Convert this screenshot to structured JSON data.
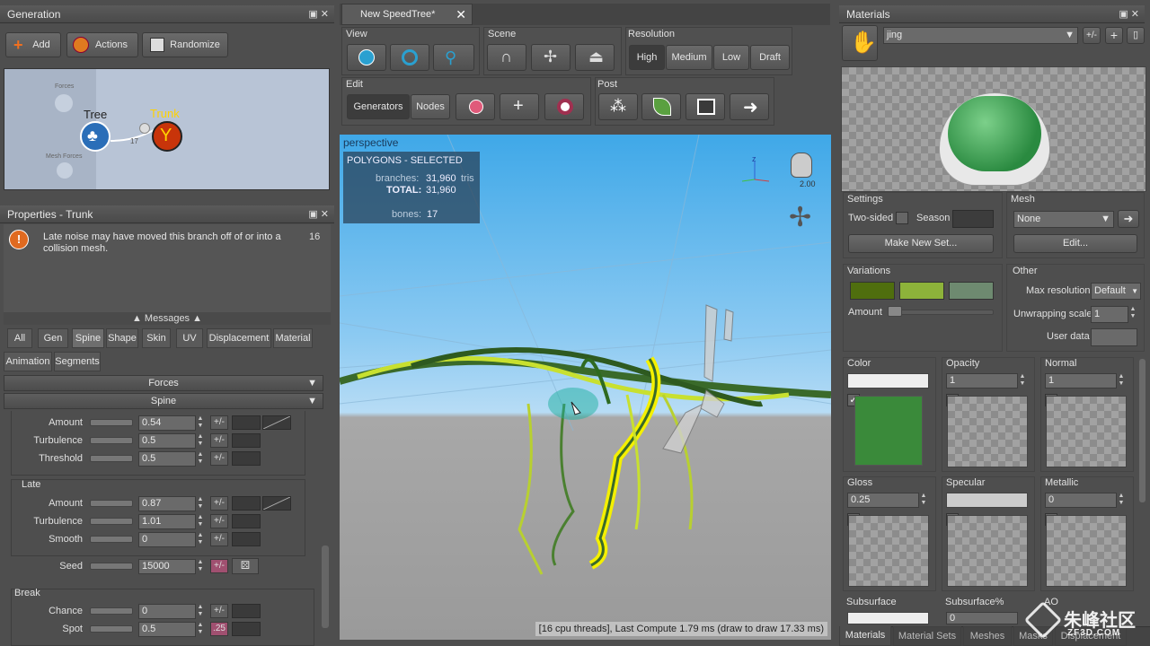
{
  "generation": {
    "title": "Generation",
    "add": "Add",
    "actions": "Actions",
    "randomize": "Randomize",
    "node_tree": "Tree",
    "node_trunk": "Trunk",
    "node_forces": "Forces",
    "node_mesh_forces": "Mesh Forces",
    "link_count": "17"
  },
  "properties": {
    "title": "Properties - Trunk",
    "message": "Late noise may have moved this branch off of or into a collision mesh.",
    "message_count": "16",
    "messages_header": "Messages",
    "tabs": [
      "All",
      "Gen",
      "Spine",
      "Shape",
      "Skin",
      "UV",
      "Displacement",
      "Material",
      "Animation",
      "Segments"
    ],
    "section_forces": "Forces",
    "section_spine": "Spine",
    "rows1": [
      {
        "label": "Amount",
        "value": "0.54"
      },
      {
        "label": "Turbulence",
        "value": "0.5"
      },
      {
        "label": "Threshold",
        "value": "0.5"
      }
    ],
    "late_label": "Late",
    "rows2": [
      {
        "label": "Amount",
        "value": "0.87"
      },
      {
        "label": "Turbulence",
        "value": "1.01"
      },
      {
        "label": "Smooth",
        "value": "0"
      }
    ],
    "seed_label": "Seed",
    "seed_value": "15000",
    "break_label": "Break",
    "rows3": [
      {
        "label": "Chance",
        "value": "0"
      },
      {
        "label": "Spot",
        "value": "0.5",
        "badge": ".25"
      }
    ],
    "pm": "+/-"
  },
  "doc": {
    "tab": "New SpeedTree*",
    "close": "✕"
  },
  "toolbar": {
    "view": "View",
    "scene": "Scene",
    "resolution": "Resolution",
    "res_options": [
      "High",
      "Medium",
      "Low",
      "Draft"
    ],
    "edit": "Edit",
    "generators": "Generators",
    "nodes": "Nodes",
    "post": "Post"
  },
  "viewport": {
    "label": "perspective",
    "info_title": "POLYGONS - SELECTED",
    "branches_label": "branches:",
    "branches_value": "31,960",
    "tris": "tris",
    "total_label": "TOTAL:",
    "total_value": "31,960",
    "bones_label": "bones:",
    "bones_value": "17",
    "zoom": "2.00",
    "axis_z": "z",
    "status": "[16 cpu threads], Last Compute 1.79 ms (draw to draw 17.33 ms)"
  },
  "materials": {
    "title": "Materials",
    "name": "jing",
    "settings": "Settings",
    "two_sided": "Two-sided",
    "season": "Season",
    "make_new_set": "Make New Set...",
    "mesh": "Mesh",
    "mesh_value": "None",
    "edit": "Edit...",
    "variations": "Variations",
    "amount": "Amount",
    "other": "Other",
    "max_res_label": "Max resolution",
    "max_res_value": "Default",
    "unwrap_label": "Unwrapping scale",
    "unwrap_value": "1",
    "user_data": "User data",
    "color": "Color",
    "opacity": "Opacity",
    "opacity_value": "1",
    "normal": "Normal",
    "normal_value": "1",
    "gloss": "Gloss",
    "gloss_value": "0.25",
    "specular": "Specular",
    "metallic": "Metallic",
    "metallic_value": "0",
    "subsurface": "Subsurface",
    "subsurface_pct": "Subsurface%",
    "subsurface_pct_value": "0",
    "ao": "AO",
    "bottom_tabs": [
      "Materials",
      "Material Sets",
      "Meshes",
      "Masks",
      "Displacement"
    ],
    "var_colors": [
      "#4f6e0e",
      "#8db33a",
      "#6e8a70"
    ],
    "color_swatch": "#3a8a3a"
  },
  "watermark": {
    "text": "朱峰社区",
    "sub": "ZF3D.COM"
  }
}
